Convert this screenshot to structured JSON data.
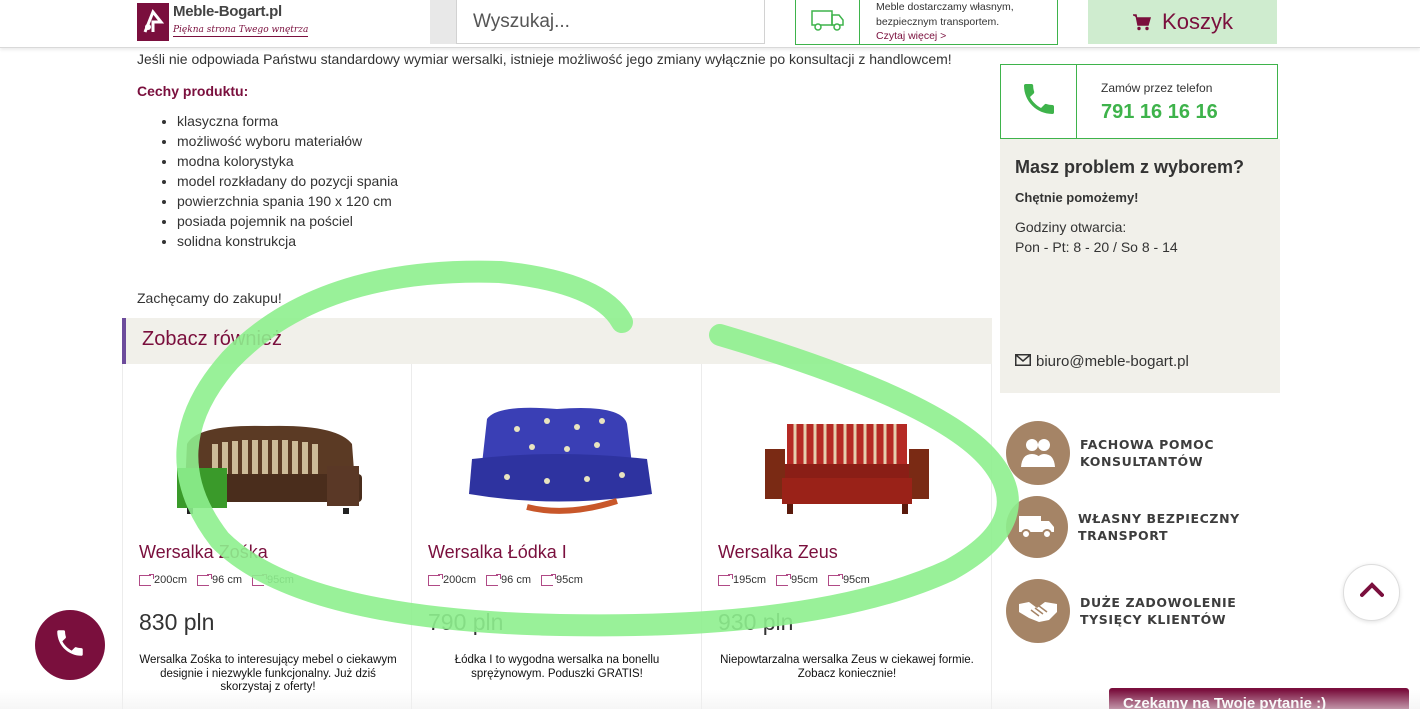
{
  "header": {
    "logo_name": "Meble-Bogart.pl",
    "logo_slogan": "Piękna strona Twego wnętrza",
    "search_placeholder": "Wyszukaj...",
    "delivery_line1": "Meble dostarczamy własnym,",
    "delivery_line2": "bezpiecznym transportem.",
    "delivery_link": "Czytaj więcej >",
    "cart_label": "Koszyk"
  },
  "main": {
    "intro": "Jeśli nie odpowiada Państwu standardowy wymiar wersalki, istnieje możliwość jego zmiany wyłącznie po konsultacji z handlowcem!",
    "features_title": "Cechy produktu:",
    "features": [
      "klasyczna forma",
      "możliwość wyboru materiałów",
      "modna kolorystyka",
      "model rozkładany do pozycji spania",
      "powierzchnia spania 190 x 120 cm",
      "posiada pojemnik na pościel",
      "solidna konstrukcja"
    ],
    "outro": "Zachęcamy do zakupu!",
    "see_also_title": "Zobacz również"
  },
  "products": [
    {
      "name": "Wersalka Zośka",
      "dims": [
        "200cm",
        "96 cm",
        "95cm"
      ],
      "price": "830 pln",
      "desc": "Wersalka Zośka to interesujący mebel o ciekawym designie i niezwykle funkcjonalny. Już dziś skorzystaj z oferty!"
    },
    {
      "name": "Wersalka Łódka I",
      "dims": [
        "200cm",
        "96 cm",
        "95cm"
      ],
      "price": "790 pln",
      "desc": "Łódka I to wygodna wersalka na bonellu sprężynowym. Poduszki GRATIS!"
    },
    {
      "name": "Wersalka Zeus",
      "dims": [
        "195cm",
        "95cm",
        "95cm"
      ],
      "price": "930 pln",
      "desc": "Niepowtarzalna wersalka Zeus w ciekawej formie. Zobacz koniecznie!"
    }
  ],
  "sidebar": {
    "phone_label": "Zamów przez telefon",
    "phone_number": "791 16 16 16",
    "help_title": "Masz problem z wyborem?",
    "help_sub": "Chętnie pomożemy!",
    "hours_label": "Godziny otwarcia:",
    "hours": "Pon - Pt: 8 - 20 / So 8 - 14",
    "email": "biuro@meble-bogart.pl",
    "benefits": [
      {
        "line1": "FACHOWA POMOC",
        "line2": "KONSULTANTÓW",
        "icon": "consultants-icon"
      },
      {
        "line1": "WŁASNY BEZPIECZNY",
        "line2": "TRANSPORT",
        "icon": "truck-icon"
      },
      {
        "line1": "DUŻE ZADOWOLENIE",
        "line2": "TYSIĘCY KLIENTÓW",
        "icon": "handshake-icon"
      }
    ]
  },
  "chat_label": "Czekamy na Twoje pytanie :)",
  "colors": {
    "brand": "#7a0f3d",
    "accent_green": "#3eb34b",
    "panel_bg": "#f1f0ea",
    "benefit_icon": "#a58466",
    "annotation_stroke": "#8ef08e"
  }
}
